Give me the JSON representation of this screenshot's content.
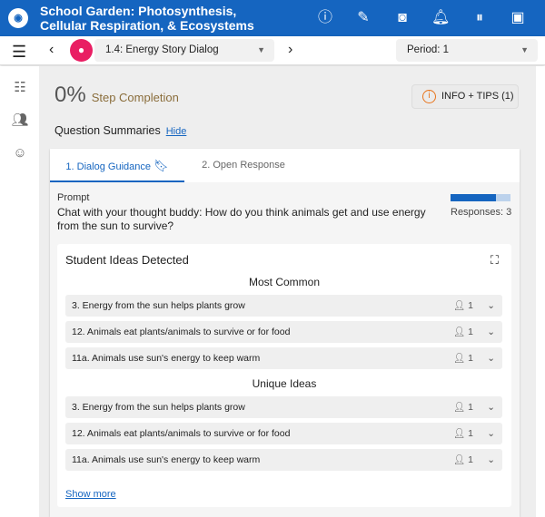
{
  "header": {
    "logo": "WISE",
    "title": "School Garden: Photosynthesis, Cellular Respiration, & Ecosystems",
    "icons": [
      "info-icon",
      "edit-icon",
      "preview-icon",
      "notifications-icon",
      "pause-icon",
      "account-icon"
    ]
  },
  "toolbar": {
    "step": "1.4: Energy Story Dialog",
    "period": "Period: 1"
  },
  "main": {
    "completion": "0%",
    "completion_label": "Step Completion",
    "info_button": "INFO + TIPS (1)",
    "summaries": "Question Summaries",
    "hide": "Hide"
  },
  "card": {
    "tabs": [
      "1. Dialog Guidance",
      "2. Open Response"
    ],
    "prompt_label": "Prompt",
    "prompt": "Chat with your thought buddy: How do you think animals get and use energy from the sun to survive?",
    "progress_percent": 75,
    "responses": "Responses: 3"
  },
  "ideas": {
    "title": "Student Ideas Detected",
    "most_common": "Most Common",
    "unique": "Unique Ideas",
    "most_common_items": [
      {
        "label": "3. Energy from the sun helps plants grow",
        "count": "1"
      },
      {
        "label": "12. Animals eat plants/animals to survive or for food",
        "count": "1"
      },
      {
        "label": "11a. Animals use sun's energy to keep warm",
        "count": "1"
      }
    ],
    "unique_items": [
      {
        "label": "3. Energy from the sun helps plants grow",
        "count": "1"
      },
      {
        "label": "12. Animals eat plants/animals to survive or for food",
        "count": "1"
      },
      {
        "label": "11a. Animals use sun's energy to keep warm",
        "count": "1"
      }
    ],
    "show_more": "Show more"
  }
}
